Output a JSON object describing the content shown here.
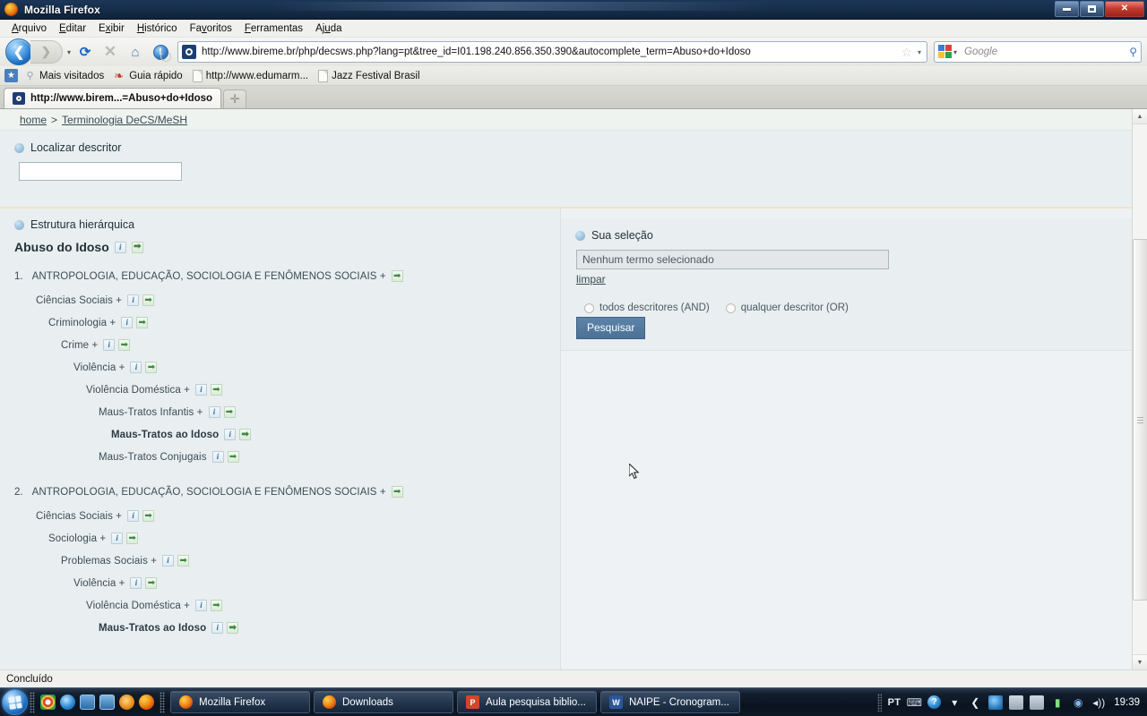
{
  "window": {
    "title": "Mozilla Firefox",
    "controls": {
      "minimize": "–",
      "restore": "❐",
      "close": "✕"
    }
  },
  "menubar": [
    {
      "label": "Arquivo"
    },
    {
      "label": "Editar"
    },
    {
      "label": "Exibir"
    },
    {
      "label": "Histórico"
    },
    {
      "label": "Favoritos"
    },
    {
      "label": "Ferramentas"
    },
    {
      "label": "Ajuda"
    }
  ],
  "navbar": {
    "back_icon": "❮",
    "forward_icon": "❯",
    "reload_icon": "⟳",
    "stop_icon": "✕",
    "home_icon": "⌂",
    "alert_icon": "!",
    "url": "http://www.bireme.br/php/decsws.php?lang=pt&tree_id=I01.198.240.856.350.390&autocomplete_term=Abuso+do+Idoso",
    "star_icon": "☆",
    "caret_icon": "▾",
    "search_placeholder": "Google",
    "search_value": "",
    "magnifier_icon": "⚲"
  },
  "bookmarks": [
    {
      "label": "Mais visitados",
      "icon": "magnifier-icon"
    },
    {
      "label": "Guia rápido",
      "icon": "rss-icon"
    },
    {
      "label": "http://www.edumarm...",
      "icon": "document-icon"
    },
    {
      "label": "Jazz Festival Brasil",
      "icon": "document-icon"
    }
  ],
  "tabs": {
    "active": {
      "title": "http://www.birem...=Abuso+do+Idoso"
    },
    "newtab_icon": "✛"
  },
  "page": {
    "breadcrumb": {
      "home": "home",
      "separator": ">",
      "current": "Terminologia DeCS/MeSH"
    },
    "find": {
      "heading": "Localizar descritor",
      "input_value": "",
      "input_placeholder": ""
    },
    "tree_panel": {
      "heading": "Estrutura hierárquica",
      "descriptor": "Abuso do Idoso",
      "descriptor_icons": [
        "info-icon",
        "go-icon"
      ],
      "trees": [
        {
          "number": "1.",
          "nodes": [
            {
              "label": "ANTROPOLOGIA, EDUCAÇÃO, SOCIOLOGIA E FENÔMENOS SOCIAIS +",
              "indent": 0,
              "bold": false,
              "info": false,
              "go": true
            },
            {
              "label": "Ciências Sociais +",
              "indent": 1,
              "bold": false,
              "info": true,
              "go": true
            },
            {
              "label": "Criminologia +",
              "indent": 2,
              "bold": false,
              "info": true,
              "go": true
            },
            {
              "label": "Crime +",
              "indent": 3,
              "bold": false,
              "info": true,
              "go": true
            },
            {
              "label": "Violência +",
              "indent": 4,
              "bold": false,
              "info": true,
              "go": true
            },
            {
              "label": "Violência Doméstica +",
              "indent": 5,
              "bold": false,
              "info": true,
              "go": true
            },
            {
              "label": "Maus-Tratos Infantis +",
              "indent": 6,
              "bold": false,
              "info": true,
              "go": true
            },
            {
              "label": "Maus-Tratos ao Idoso",
              "indent": 7,
              "bold": true,
              "info": true,
              "go": true
            },
            {
              "label": "Maus-Tratos Conjugais",
              "indent": 6,
              "bold": false,
              "info": true,
              "go": true
            }
          ]
        },
        {
          "number": "2.",
          "nodes": [
            {
              "label": "ANTROPOLOGIA, EDUCAÇÃO, SOCIOLOGIA E FENÔMENOS SOCIAIS +",
              "indent": 0,
              "bold": false,
              "info": false,
              "go": true
            },
            {
              "label": "Ciências Sociais +",
              "indent": 1,
              "bold": false,
              "info": true,
              "go": true
            },
            {
              "label": "Sociologia +",
              "indent": 2,
              "bold": false,
              "info": true,
              "go": true
            },
            {
              "label": "Problemas Sociais +",
              "indent": 3,
              "bold": false,
              "info": true,
              "go": true
            },
            {
              "label": "Violência +",
              "indent": 4,
              "bold": false,
              "info": true,
              "go": true
            },
            {
              "label": "Violência Doméstica +",
              "indent": 5,
              "bold": false,
              "info": true,
              "go": true
            },
            {
              "label": "Maus-Tratos ao Idoso",
              "indent": 6,
              "bold": true,
              "info": true,
              "go": true
            }
          ]
        }
      ]
    },
    "selection_panel": {
      "heading": "Sua seleção",
      "selection_text": "Nenhum termo selecionado",
      "clear_link": "limpar",
      "radio_and": "todos descritores (AND)",
      "radio_or": "qualquer descritor (OR)",
      "search_button": "Pesquisar"
    }
  },
  "statusbar": {
    "text": "Concluído"
  },
  "taskbar": {
    "quicklaunch": [
      "chrome-icon",
      "internet-explorer-icon",
      "show-desktop-icon",
      "media-player-icon",
      "media-center-icon",
      "firefox-icon"
    ],
    "tasks": [
      {
        "label": "Mozilla Firefox",
        "icon": "firefox-icon"
      },
      {
        "label": "Downloads",
        "icon": "firefox-icon"
      },
      {
        "label": "Aula pesquisa biblio...",
        "icon": "powerpoint-icon"
      },
      {
        "label": "NAIPE - Cronogram...",
        "icon": "word-icon"
      }
    ],
    "tray": {
      "language": "PT",
      "keyboard_icon": "⌨",
      "help_icon": "?",
      "caret_icon": "▾",
      "chevron_icon": "❮",
      "battery_icon": "▮",
      "network_icon": "◉",
      "volume_icon": "◂))",
      "clock": "19:39"
    }
  },
  "colors": {
    "accent_blue": "#4b7196",
    "panel_bg": "#e9eef0",
    "page_bg": "#eef2f4",
    "close_red": "#c0392f"
  }
}
